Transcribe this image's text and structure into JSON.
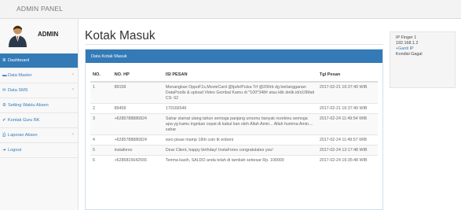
{
  "app": {
    "title": "ADMIN PANEL"
  },
  "profile": {
    "username": "ADMIN"
  },
  "sidebar": {
    "items": [
      {
        "label": "Dashboard",
        "icon": "≣",
        "chevron": ""
      },
      {
        "label": "Data Master",
        "icon": "▬",
        "chevron": "‹"
      },
      {
        "label": "Data SMS",
        "icon": "✉",
        "chevron": "‹"
      },
      {
        "label": "Setting Waktu Absen",
        "icon": "⚙",
        "chevron": ""
      },
      {
        "label": "Kontak Guru BK",
        "icon": "✔",
        "chevron": ""
      },
      {
        "label": "Laporan Absen",
        "icon": "⎙",
        "chevron": "‹"
      },
      {
        "label": "Logout",
        "icon": "➜",
        "chevron": ""
      }
    ]
  },
  "page": {
    "title": "Kotak Masuk"
  },
  "panel": {
    "heading": "Data Kotak Masuk",
    "columns": [
      "NO.",
      "NO. HP",
      "ISI PESAN",
      "Tgl Pesan"
    ],
    "rows": [
      {
        "no": "1",
        "hp": "89158",
        "msg": "Menangkan OppoF1s,MovieCard @tjufe/Pulsa Trf @200rb dg berlangganan DataPoolls & upload Video Gombal Kamu di *100*348# atau klik detik.id/s10Mati CS: 62",
        "tgl": "2017-02-21 16:37:49 WIB"
      },
      {
        "no": "2",
        "hp": "89458",
        "msg": "179166546",
        "tgl": "2017-02-21 16:37:49 WIB"
      },
      {
        "no": "3",
        "hp": "+6285788886824",
        "msg": "Sahar slamat ulang tahun semoga panjang umurnu banyak rezekinu semoga apa yg kamu ingnkan cepat di kabul kan oleh Allah Amin... Allah humma Amin.... sahar",
        "tgl": "2017-02-24 11:49:54 WIB"
      },
      {
        "no": "4",
        "hp": "+6285788886824",
        "msg": "iseo pisae mamp 18rb coin tk enbeni",
        "tgl": "2017-02-24 11:49:57 WIB"
      },
      {
        "no": "5",
        "hp": "instaforex",
        "msg": "Dear Client, happy birthday! InstaForex congratulates you!",
        "tgl": "2017-02-24 12:17:48 WIB"
      },
      {
        "no": "6",
        "hp": "+6285815642555",
        "msg": "Terima kasih, SALDO anda telah di tambah sebesar Rp. 100000",
        "tgl": "2017-02-24 16:35:48 WIB"
      }
    ]
  },
  "info": {
    "line1": "IP Finger 1",
    "line2": "192.168.1.2",
    "link": "+Ganti IP",
    "status": "Kondisi Gagal"
  }
}
